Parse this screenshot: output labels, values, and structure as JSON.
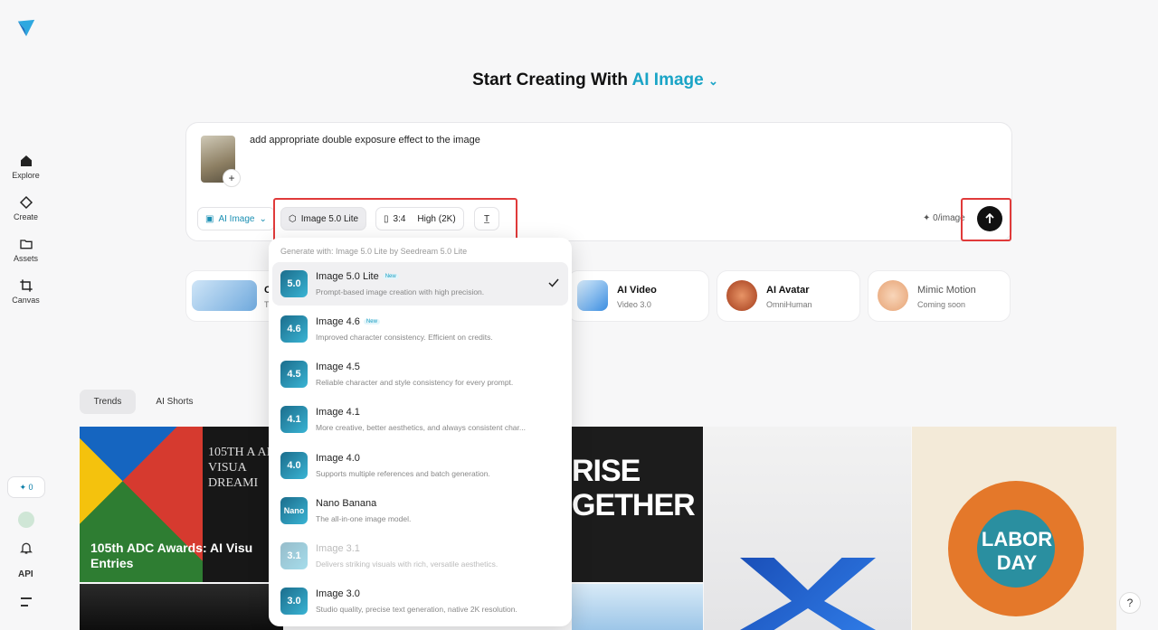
{
  "sidebar": {
    "items": [
      {
        "label": "Explore",
        "icon": "home-icon"
      },
      {
        "label": "Create",
        "icon": "diamond-icon"
      },
      {
        "label": "Assets",
        "icon": "folder-icon"
      },
      {
        "label": "Canvas",
        "icon": "crop-icon"
      }
    ],
    "credits": "0",
    "api_label": "API"
  },
  "heading": {
    "prefix": "Start Creating With",
    "accent": "AI Image"
  },
  "prompt": {
    "text": "add appropriate double exposure effect to the image",
    "mode_label": "AI Image",
    "model_label": "Image 5.0 Lite",
    "ratio_label": "3:4",
    "quality_label": "High (2K)",
    "price_label": "0/image"
  },
  "features": [
    {
      "title": "C",
      "sub": "Tr"
    },
    {
      "title": "AI Video",
      "sub": "Video 3.0"
    },
    {
      "title": "AI Avatar",
      "sub": "OmniHuman"
    },
    {
      "title": "Mimic Motion",
      "sub": "Coming soon"
    }
  ],
  "tabs": [
    "Trends",
    "AI Shorts"
  ],
  "gallery": {
    "caption": "105th ADC Awards: AI Visu Entries",
    "poster_text": "105TH A AI VISUA DREAMI",
    "rise_text": "RISE GETHER",
    "labor_text": "LABOR DAY"
  },
  "dropdown": {
    "header": "Generate with: Image 5.0 Lite by Seedream 5.0 Lite",
    "items": [
      {
        "code": "5.0",
        "name": "Image 5.0 Lite",
        "badge": "New",
        "desc": "Prompt-based image creation with high precision."
      },
      {
        "code": "4.6",
        "name": "Image 4.6",
        "badge": "New",
        "desc": "Improved character consistency. Efficient on credits."
      },
      {
        "code": "4.5",
        "name": "Image 4.5",
        "badge": "",
        "desc": "Reliable character and style consistency for every prompt."
      },
      {
        "code": "4.1",
        "name": "Image 4.1",
        "badge": "",
        "desc": "More creative, better aesthetics, and always consistent char..."
      },
      {
        "code": "4.0",
        "name": "Image 4.0",
        "badge": "",
        "desc": "Supports multiple references and batch generation."
      },
      {
        "code": "Nano",
        "name": "Nano Banana",
        "badge": "",
        "desc": "The all-in-one image model."
      },
      {
        "code": "3.1",
        "name": "Image 3.1",
        "badge": "",
        "desc": "Delivers striking visuals with rich, versatile aesthetics."
      },
      {
        "code": "3.0",
        "name": "Image 3.0",
        "badge": "",
        "desc": "Studio quality, precise text generation, native 2K resolution."
      }
    ]
  },
  "colors": {
    "accent": "#1aa4c6",
    "highlight": "#e03a3a"
  }
}
